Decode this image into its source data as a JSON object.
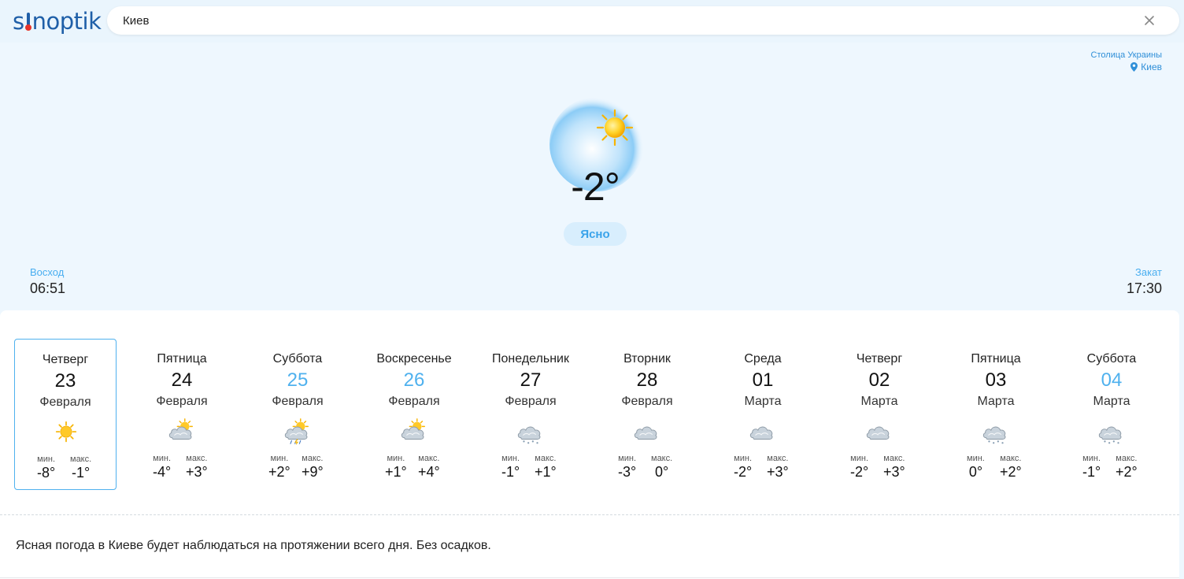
{
  "header": {
    "logo": "sinoptik",
    "search": {
      "value": "Киев",
      "placeholder": ""
    }
  },
  "location": {
    "caption": "Столица Украины",
    "city": "Киев"
  },
  "current": {
    "temperature": "-2°",
    "condition": "Ясно",
    "icon": "sunny-icon"
  },
  "sun": {
    "sunrise_label": "Восход",
    "sunrise_time": "06:51",
    "sunset_label": "Закат",
    "sunset_time": "17:30"
  },
  "forecast": {
    "min_label": "мин.",
    "max_label": "макс.",
    "days": [
      {
        "name": "Четверг",
        "date": "23",
        "month": "Февраля",
        "icon": "sun-icon",
        "min": "-8°",
        "max": "-1°",
        "weekend": false,
        "selected": true
      },
      {
        "name": "Пятница",
        "date": "24",
        "month": "Февраля",
        "icon": "partly-cloudy-icon",
        "min": "-4°",
        "max": "+3°",
        "weekend": false,
        "selected": false
      },
      {
        "name": "Суббота",
        "date": "25",
        "month": "Февраля",
        "icon": "thunderstorm-icon",
        "min": "+2°",
        "max": "+9°",
        "weekend": true,
        "selected": false
      },
      {
        "name": "Воскресенье",
        "date": "26",
        "month": "Февраля",
        "icon": "partly-cloudy-icon",
        "min": "+1°",
        "max": "+4°",
        "weekend": true,
        "selected": false
      },
      {
        "name": "Понедельник",
        "date": "27",
        "month": "Февраля",
        "icon": "snow-cloud-icon",
        "min": "-1°",
        "max": "+1°",
        "weekend": false,
        "selected": false
      },
      {
        "name": "Вторник",
        "date": "28",
        "month": "Февраля",
        "icon": "cloudy-icon",
        "min": "-3°",
        "max": "0°",
        "weekend": false,
        "selected": false
      },
      {
        "name": "Среда",
        "date": "01",
        "month": "Марта",
        "icon": "cloudy-icon",
        "min": "-2°",
        "max": "+3°",
        "weekend": false,
        "selected": false
      },
      {
        "name": "Четверг",
        "date": "02",
        "month": "Марта",
        "icon": "cloudy-icon",
        "min": "-2°",
        "max": "+3°",
        "weekend": false,
        "selected": false
      },
      {
        "name": "Пятница",
        "date": "03",
        "month": "Марта",
        "icon": "snow-cloud-icon",
        "min": "0°",
        "max": "+2°",
        "weekend": false,
        "selected": false
      },
      {
        "name": "Суббота",
        "date": "04",
        "month": "Марта",
        "icon": "snow-cloud-icon",
        "min": "-1°",
        "max": "+2°",
        "weekend": true,
        "selected": false
      }
    ]
  },
  "summary": "Ясная погода в Киеве будет наблюдаться на протяжении всего дня. Без осадков.",
  "colors": {
    "accent": "#4fb1ee",
    "brand": "#1f5fa8",
    "background": "#eef7fe"
  }
}
